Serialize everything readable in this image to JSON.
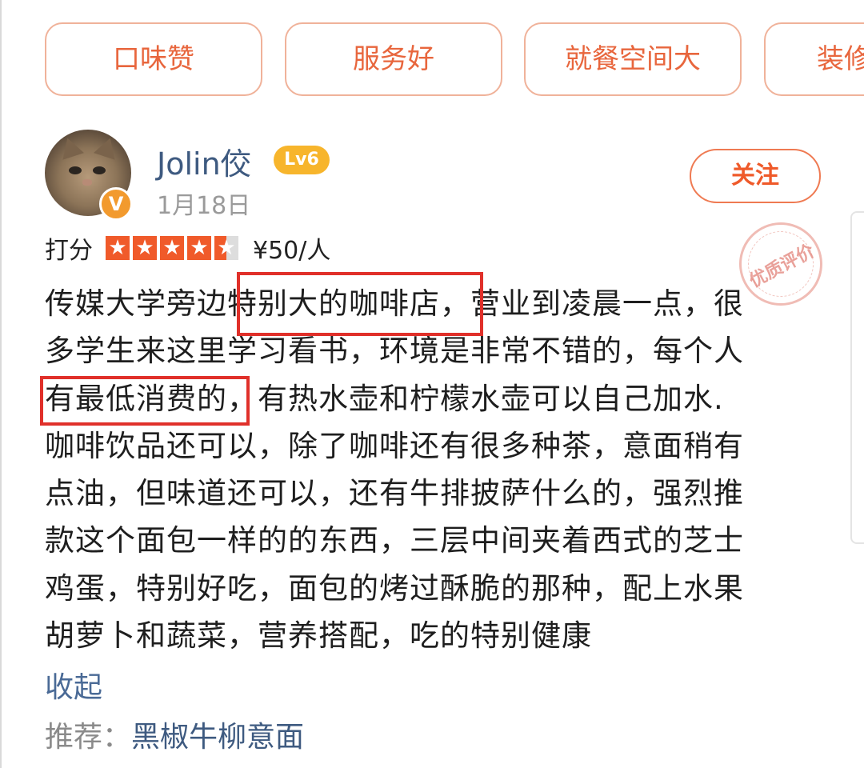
{
  "tags": [
    {
      "label": "口味赞"
    },
    {
      "label": "服务好"
    },
    {
      "label": "就餐空间大"
    },
    {
      "label": "装修"
    }
  ],
  "review": {
    "user": {
      "name": "Jolin佼",
      "level": "Lv6",
      "verified_badge": "V",
      "date": "1月18日"
    },
    "follow_label": "关注",
    "stamp_text": "优质评价",
    "rating": {
      "label": "打分",
      "stars": 4.5,
      "max_stars": 5,
      "price": "¥50/人"
    },
    "lines": [
      "传媒大学旁边特别大的咖啡店，营业到凌晨一点，很",
      "多学生来这里学习看书，环境是非常不错的，每个人",
      "有最低消费的，有热水壶和柠檬水壶可以自己加水.",
      "咖啡饮品还可以，除了咖啡还有很多种茶，意面稍有",
      "点油，但味道还可以，还有牛排披萨什么的，强烈推",
      "款这个面包一样的的东西，三层中间夹着西式的芝士",
      "鸡蛋，特别好吃，面包的烤过酥脆的那种，配上水果",
      "胡萝卜和蔬菜，营养搭配，吃的特别健康"
    ],
    "collapse_label": "收起",
    "recommend_label": "推荐：",
    "recommend_dish": "黑椒牛柳意面"
  },
  "colors": {
    "accent_orange": "#e8663d",
    "highlight_red": "#e0302a",
    "link_blue": "#3e5a80",
    "level_gold": "#f7b52c"
  }
}
